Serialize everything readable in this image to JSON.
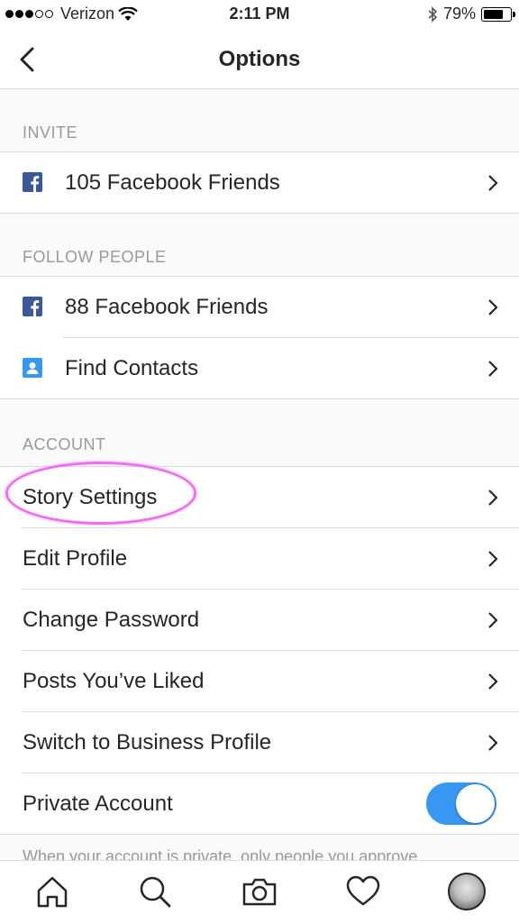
{
  "status_bar": {
    "carrier": "Verizon",
    "time": "2:11 PM",
    "battery": "79%",
    "battery_level": 0.79
  },
  "nav": {
    "title": "Options",
    "back_icon": "chevron-left-icon"
  },
  "sections": {
    "invite": {
      "header": "INVITE",
      "items": [
        {
          "label": "105 Facebook Friends",
          "icon": "facebook-icon"
        }
      ]
    },
    "follow_people": {
      "header": "FOLLOW PEOPLE",
      "items": [
        {
          "label": "88 Facebook Friends",
          "icon": "facebook-icon"
        },
        {
          "label": "Find Contacts",
          "icon": "contacts-icon"
        }
      ]
    },
    "account": {
      "header": "ACCOUNT",
      "items": [
        {
          "label": "Story Settings"
        },
        {
          "label": "Edit Profile"
        },
        {
          "label": "Change Password"
        },
        {
          "label": "Posts You’ve Liked"
        },
        {
          "label": "Switch to Business Profile"
        },
        {
          "label": "Private Account",
          "toggle_on": true
        }
      ],
      "footnote": "When your account is private, only people you approve"
    }
  },
  "tab_bar": {
    "items": [
      "home-icon",
      "search-icon",
      "camera-icon",
      "heart-icon",
      "profile-avatar"
    ]
  },
  "colors": {
    "accent": "#3897f0",
    "facebook": "#3b5998",
    "annotation": "#f06ef0"
  }
}
